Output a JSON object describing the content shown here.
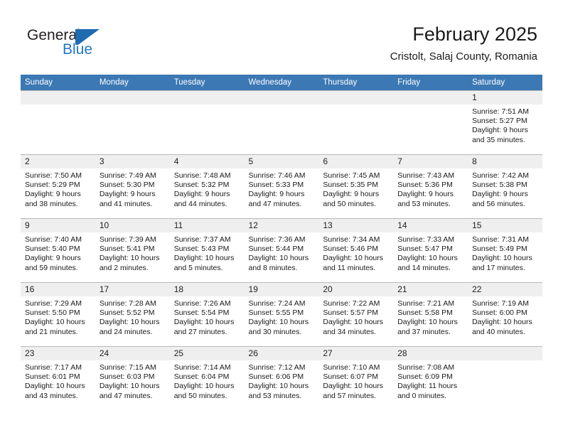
{
  "brand": {
    "name_part1": "General",
    "name_part2": "Blue",
    "logo_icon": "general-blue-triangle-logo",
    "accent_color": "#2277c8"
  },
  "header": {
    "title": "February 2025",
    "subtitle": "Cristolt, Salaj County, Romania"
  },
  "theme": {
    "header_blue": "#3b78b4",
    "day_band_gray": "#efefef",
    "cell_border": "#b9b9b9"
  },
  "weekdays": [
    "Sunday",
    "Monday",
    "Tuesday",
    "Wednesday",
    "Thursday",
    "Friday",
    "Saturday"
  ],
  "labels": {
    "sunrise_prefix": "Sunrise:",
    "sunset_prefix": "Sunset:",
    "daylight_prefix": "Daylight:"
  },
  "weeks": [
    [
      {
        "empty": true
      },
      {
        "empty": true
      },
      {
        "empty": true
      },
      {
        "empty": true
      },
      {
        "empty": true
      },
      {
        "empty": true
      },
      {
        "day": "1",
        "sunrise": "Sunrise: 7:51 AM",
        "sunset": "Sunset: 5:27 PM",
        "daylight_line1": "Daylight: 9 hours",
        "daylight_line2": "and 35 minutes."
      }
    ],
    [
      {
        "day": "2",
        "sunrise": "Sunrise: 7:50 AM",
        "sunset": "Sunset: 5:29 PM",
        "daylight_line1": "Daylight: 9 hours",
        "daylight_line2": "and 38 minutes."
      },
      {
        "day": "3",
        "sunrise": "Sunrise: 7:49 AM",
        "sunset": "Sunset: 5:30 PM",
        "daylight_line1": "Daylight: 9 hours",
        "daylight_line2": "and 41 minutes."
      },
      {
        "day": "4",
        "sunrise": "Sunrise: 7:48 AM",
        "sunset": "Sunset: 5:32 PM",
        "daylight_line1": "Daylight: 9 hours",
        "daylight_line2": "and 44 minutes."
      },
      {
        "day": "5",
        "sunrise": "Sunrise: 7:46 AM",
        "sunset": "Sunset: 5:33 PM",
        "daylight_line1": "Daylight: 9 hours",
        "daylight_line2": "and 47 minutes."
      },
      {
        "day": "6",
        "sunrise": "Sunrise: 7:45 AM",
        "sunset": "Sunset: 5:35 PM",
        "daylight_line1": "Daylight: 9 hours",
        "daylight_line2": "and 50 minutes."
      },
      {
        "day": "7",
        "sunrise": "Sunrise: 7:43 AM",
        "sunset": "Sunset: 5:36 PM",
        "daylight_line1": "Daylight: 9 hours",
        "daylight_line2": "and 53 minutes."
      },
      {
        "day": "8",
        "sunrise": "Sunrise: 7:42 AM",
        "sunset": "Sunset: 5:38 PM",
        "daylight_line1": "Daylight: 9 hours",
        "daylight_line2": "and 56 minutes."
      }
    ],
    [
      {
        "day": "9",
        "sunrise": "Sunrise: 7:40 AM",
        "sunset": "Sunset: 5:40 PM",
        "daylight_line1": "Daylight: 9 hours",
        "daylight_line2": "and 59 minutes."
      },
      {
        "day": "10",
        "sunrise": "Sunrise: 7:39 AM",
        "sunset": "Sunset: 5:41 PM",
        "daylight_line1": "Daylight: 10 hours",
        "daylight_line2": "and 2 minutes."
      },
      {
        "day": "11",
        "sunrise": "Sunrise: 7:37 AM",
        "sunset": "Sunset: 5:43 PM",
        "daylight_line1": "Daylight: 10 hours",
        "daylight_line2": "and 5 minutes."
      },
      {
        "day": "12",
        "sunrise": "Sunrise: 7:36 AM",
        "sunset": "Sunset: 5:44 PM",
        "daylight_line1": "Daylight: 10 hours",
        "daylight_line2": "and 8 minutes."
      },
      {
        "day": "13",
        "sunrise": "Sunrise: 7:34 AM",
        "sunset": "Sunset: 5:46 PM",
        "daylight_line1": "Daylight: 10 hours",
        "daylight_line2": "and 11 minutes."
      },
      {
        "day": "14",
        "sunrise": "Sunrise: 7:33 AM",
        "sunset": "Sunset: 5:47 PM",
        "daylight_line1": "Daylight: 10 hours",
        "daylight_line2": "and 14 minutes."
      },
      {
        "day": "15",
        "sunrise": "Sunrise: 7:31 AM",
        "sunset": "Sunset: 5:49 PM",
        "daylight_line1": "Daylight: 10 hours",
        "daylight_line2": "and 17 minutes."
      }
    ],
    [
      {
        "day": "16",
        "sunrise": "Sunrise: 7:29 AM",
        "sunset": "Sunset: 5:50 PM",
        "daylight_line1": "Daylight: 10 hours",
        "daylight_line2": "and 21 minutes."
      },
      {
        "day": "17",
        "sunrise": "Sunrise: 7:28 AM",
        "sunset": "Sunset: 5:52 PM",
        "daylight_line1": "Daylight: 10 hours",
        "daylight_line2": "and 24 minutes."
      },
      {
        "day": "18",
        "sunrise": "Sunrise: 7:26 AM",
        "sunset": "Sunset: 5:54 PM",
        "daylight_line1": "Daylight: 10 hours",
        "daylight_line2": "and 27 minutes."
      },
      {
        "day": "19",
        "sunrise": "Sunrise: 7:24 AM",
        "sunset": "Sunset: 5:55 PM",
        "daylight_line1": "Daylight: 10 hours",
        "daylight_line2": "and 30 minutes."
      },
      {
        "day": "20",
        "sunrise": "Sunrise: 7:22 AM",
        "sunset": "Sunset: 5:57 PM",
        "daylight_line1": "Daylight: 10 hours",
        "daylight_line2": "and 34 minutes."
      },
      {
        "day": "21",
        "sunrise": "Sunrise: 7:21 AM",
        "sunset": "Sunset: 5:58 PM",
        "daylight_line1": "Daylight: 10 hours",
        "daylight_line2": "and 37 minutes."
      },
      {
        "day": "22",
        "sunrise": "Sunrise: 7:19 AM",
        "sunset": "Sunset: 6:00 PM",
        "daylight_line1": "Daylight: 10 hours",
        "daylight_line2": "and 40 minutes."
      }
    ],
    [
      {
        "day": "23",
        "sunrise": "Sunrise: 7:17 AM",
        "sunset": "Sunset: 6:01 PM",
        "daylight_line1": "Daylight: 10 hours",
        "daylight_line2": "and 43 minutes."
      },
      {
        "day": "24",
        "sunrise": "Sunrise: 7:15 AM",
        "sunset": "Sunset: 6:03 PM",
        "daylight_line1": "Daylight: 10 hours",
        "daylight_line2": "and 47 minutes."
      },
      {
        "day": "25",
        "sunrise": "Sunrise: 7:14 AM",
        "sunset": "Sunset: 6:04 PM",
        "daylight_line1": "Daylight: 10 hours",
        "daylight_line2": "and 50 minutes."
      },
      {
        "day": "26",
        "sunrise": "Sunrise: 7:12 AM",
        "sunset": "Sunset: 6:06 PM",
        "daylight_line1": "Daylight: 10 hours",
        "daylight_line2": "and 53 minutes."
      },
      {
        "day": "27",
        "sunrise": "Sunrise: 7:10 AM",
        "sunset": "Sunset: 6:07 PM",
        "daylight_line1": "Daylight: 10 hours",
        "daylight_line2": "and 57 minutes."
      },
      {
        "day": "28",
        "sunrise": "Sunrise: 7:08 AM",
        "sunset": "Sunset: 6:09 PM",
        "daylight_line1": "Daylight: 11 hours",
        "daylight_line2": "and 0 minutes."
      },
      {
        "empty": true
      }
    ]
  ]
}
